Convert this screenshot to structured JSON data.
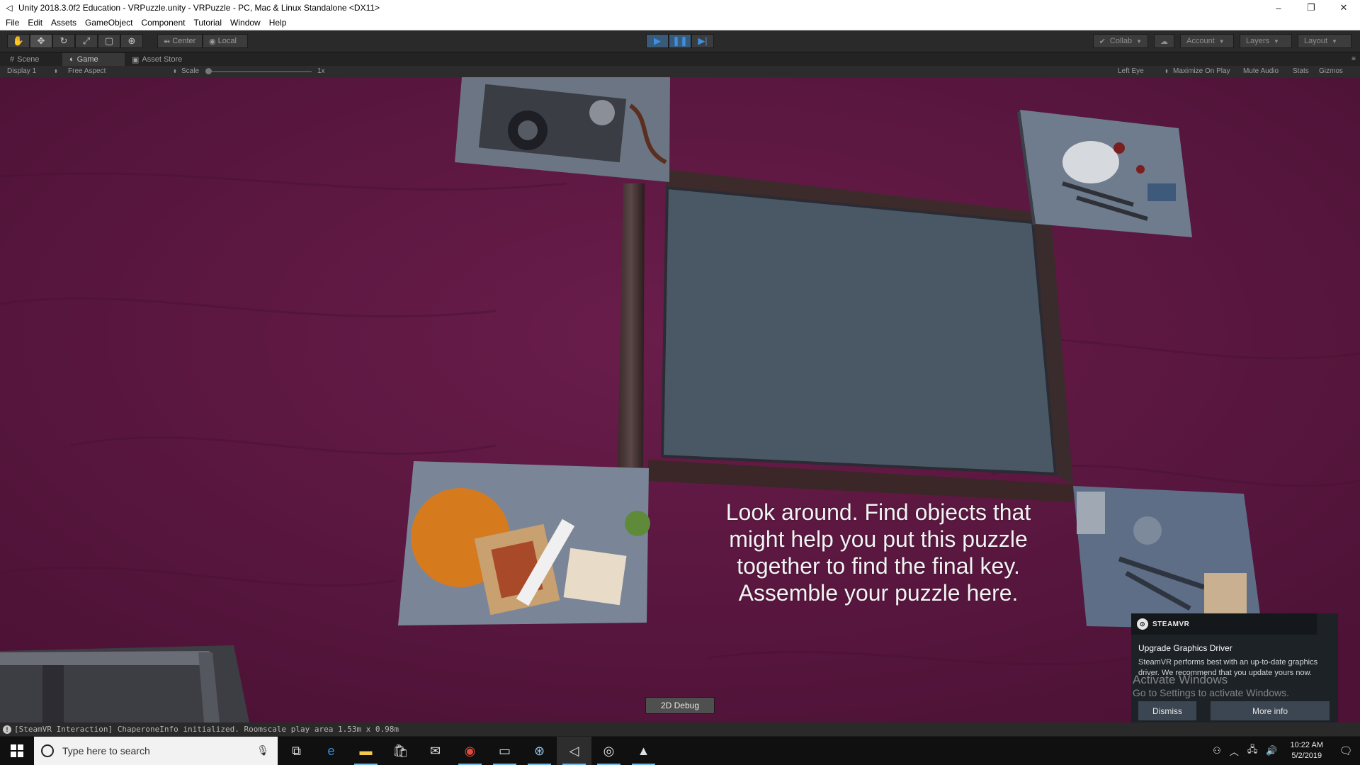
{
  "window": {
    "title": "Unity 2018.3.0f2 Education - VRPuzzle.unity - VRPuzzle - PC, Mac & Linux Standalone <DX11>",
    "minimize": "–",
    "restore": "❐",
    "close": "✕"
  },
  "menu": [
    "File",
    "Edit",
    "Assets",
    "GameObject",
    "Component",
    "Tutorial",
    "Window",
    "Help"
  ],
  "toolbar": {
    "tools": [
      "hand-tool",
      "move-tool",
      "rotate-tool",
      "scale-tool",
      "rect-tool",
      "transform-tool"
    ],
    "pivot_label": "Center",
    "space_label": "Local",
    "collab_label": "Collab",
    "account_label": "Account",
    "layers_label": "Layers",
    "layout_label": "Layout"
  },
  "tabs": {
    "scene": "Scene",
    "game": "Game",
    "asset_store": "Asset Store"
  },
  "gamebar": {
    "display": "Display 1",
    "aspect": "Free Aspect",
    "scale_label": "Scale",
    "scale_value": "1x",
    "eye": "Left Eye",
    "maximize": "Maximize On Play",
    "mute": "Mute Audio",
    "stats": "Stats",
    "gizmos": "Gizmos"
  },
  "scene": {
    "instructions": [
      "Look around. Find objects that",
      "might help you put this puzzle",
      "together to find the final key.",
      "Assemble your puzzle here."
    ],
    "debug_button": "2D Debug"
  },
  "steamvr": {
    "brand": "STEAMVR",
    "title": "Upgrade Graphics Driver",
    "body": "SteamVR performs best with an up-to-date graphics driver. We recommend that you update yours now.",
    "dismiss": "Dismiss",
    "more_info": "More info"
  },
  "watermark": {
    "line1": "Activate Windows",
    "line2": "Go to Settings to activate Windows."
  },
  "status": {
    "message": "[SteamVR Interaction] ChaperoneInfo initialized. Roomscale play area 1.53m x 0.98m"
  },
  "taskbar": {
    "search_placeholder": "Type here to search",
    "time": "10:22 AM",
    "date": "5/2/2019"
  },
  "colors": {
    "wall": "#5c1740",
    "play_blue": "#3d8fe0"
  }
}
